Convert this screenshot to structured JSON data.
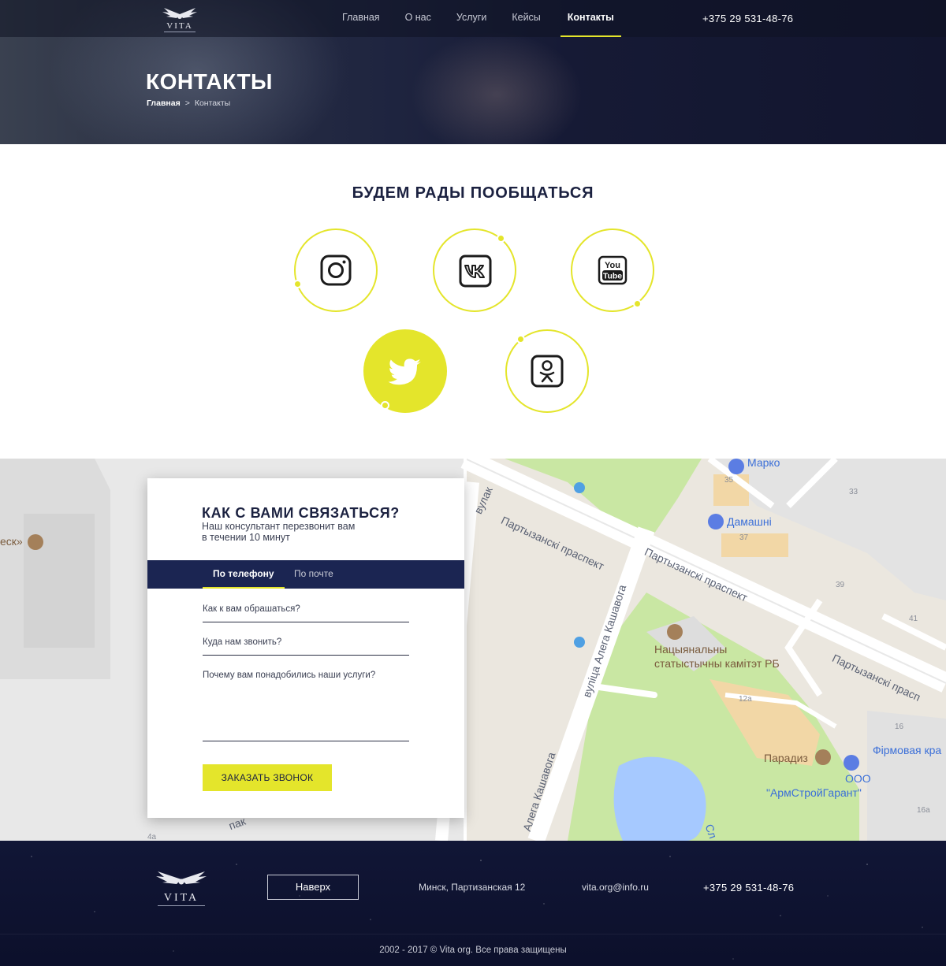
{
  "header": {
    "logo_text": "VITA",
    "nav": [
      "Главная",
      "О нас",
      "Услуги",
      "Кейсы",
      "Контакты"
    ],
    "phone": "+375 29 531-48-76"
  },
  "page": {
    "title": "КОНТАКТЫ",
    "breadcrumb_home": "Главная",
    "breadcrumb_sep": ">",
    "breadcrumb_current": "Контакты"
  },
  "social": {
    "title": "БУДЕМ РАДЫ ПООБЩАТЬСЯ",
    "items": [
      {
        "icon": "instagram-icon"
      },
      {
        "icon": "vk-icon"
      },
      {
        "icon": "youtube-icon",
        "text": "You Tube"
      },
      {
        "icon": "twitter-icon"
      },
      {
        "icon": "odnoklassniki-icon"
      }
    ],
    "accent": "#e4e52b"
  },
  "map": {
    "labels": {
      "marko": "Марко",
      "damashni": "Дамашні",
      "street1": "Партызанскі праспект",
      "street2": "Партызанскі праспект",
      "street3": "Партызанскі прасп",
      "kashavoga1": "вуліца Алега Кашавога",
      "kashavoga2": "Алега Кашавога",
      "stat1": "Нацыянальны",
      "stat2": "статыстычны камітэт РБ",
      "paradiz": "Парадиз",
      "firm": "Фірмовая кра",
      "ooo1": "ООО",
      "ooo2": "\"АрмСтройГарант\"",
      "esk": "еск»",
      "vulak": "вулак",
      "pak": "пак",
      "sl": "Сл"
    },
    "numbers": [
      "35",
      "33",
      "37",
      "39",
      "41",
      "12а",
      "16",
      "16а",
      "4а"
    ]
  },
  "form": {
    "title": "КАК С ВАМИ СВЯЗАТЬСЯ?",
    "subtitle_line1": "Наш консультант перезвонит вам",
    "subtitle_line2": "в течении 10 минут",
    "tab_phone": "По телефону",
    "tab_email": "По почте",
    "name_placeholder": "Как к вам обрашаться?",
    "phone_placeholder": "Куда нам звонить?",
    "reason_placeholder": "Почему вам понадобились наши услуги?",
    "submit": "ЗАКАЗАТЬ ЗВОНОК"
  },
  "footer": {
    "logo_text": "VITA",
    "up_button": "Наверх",
    "address": "Минск, Партизанская 12",
    "email": "vita.org@info.ru",
    "phone": "+375 29 531-48-76",
    "copyright": "2002 - 2017  ©  Vita org. Все права защищены"
  }
}
